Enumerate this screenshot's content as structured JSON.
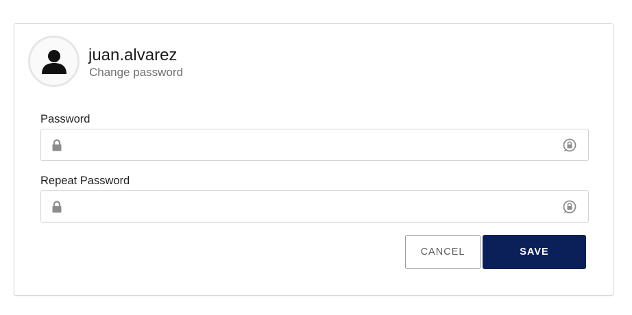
{
  "profile": {
    "username": "juan.alvarez",
    "subtitle": "Change password",
    "avatar_icon": "user-silhouette-icon"
  },
  "form": {
    "password": {
      "label": "Password",
      "value": "",
      "leading_icon": "lock-icon",
      "trailing_icon": "visibility-toggle-icon"
    },
    "repeat_password": {
      "label": "Repeat Password",
      "value": "",
      "leading_icon": "lock-icon",
      "trailing_icon": "visibility-toggle-icon"
    }
  },
  "actions": {
    "cancel_label": "CANCEL",
    "save_label": "SAVE"
  },
  "colors": {
    "primary": "#0b2059",
    "border": "#d4d4d4",
    "icon_gray": "#8c8c8c",
    "subtitle_gray": "#6f6f6f"
  }
}
